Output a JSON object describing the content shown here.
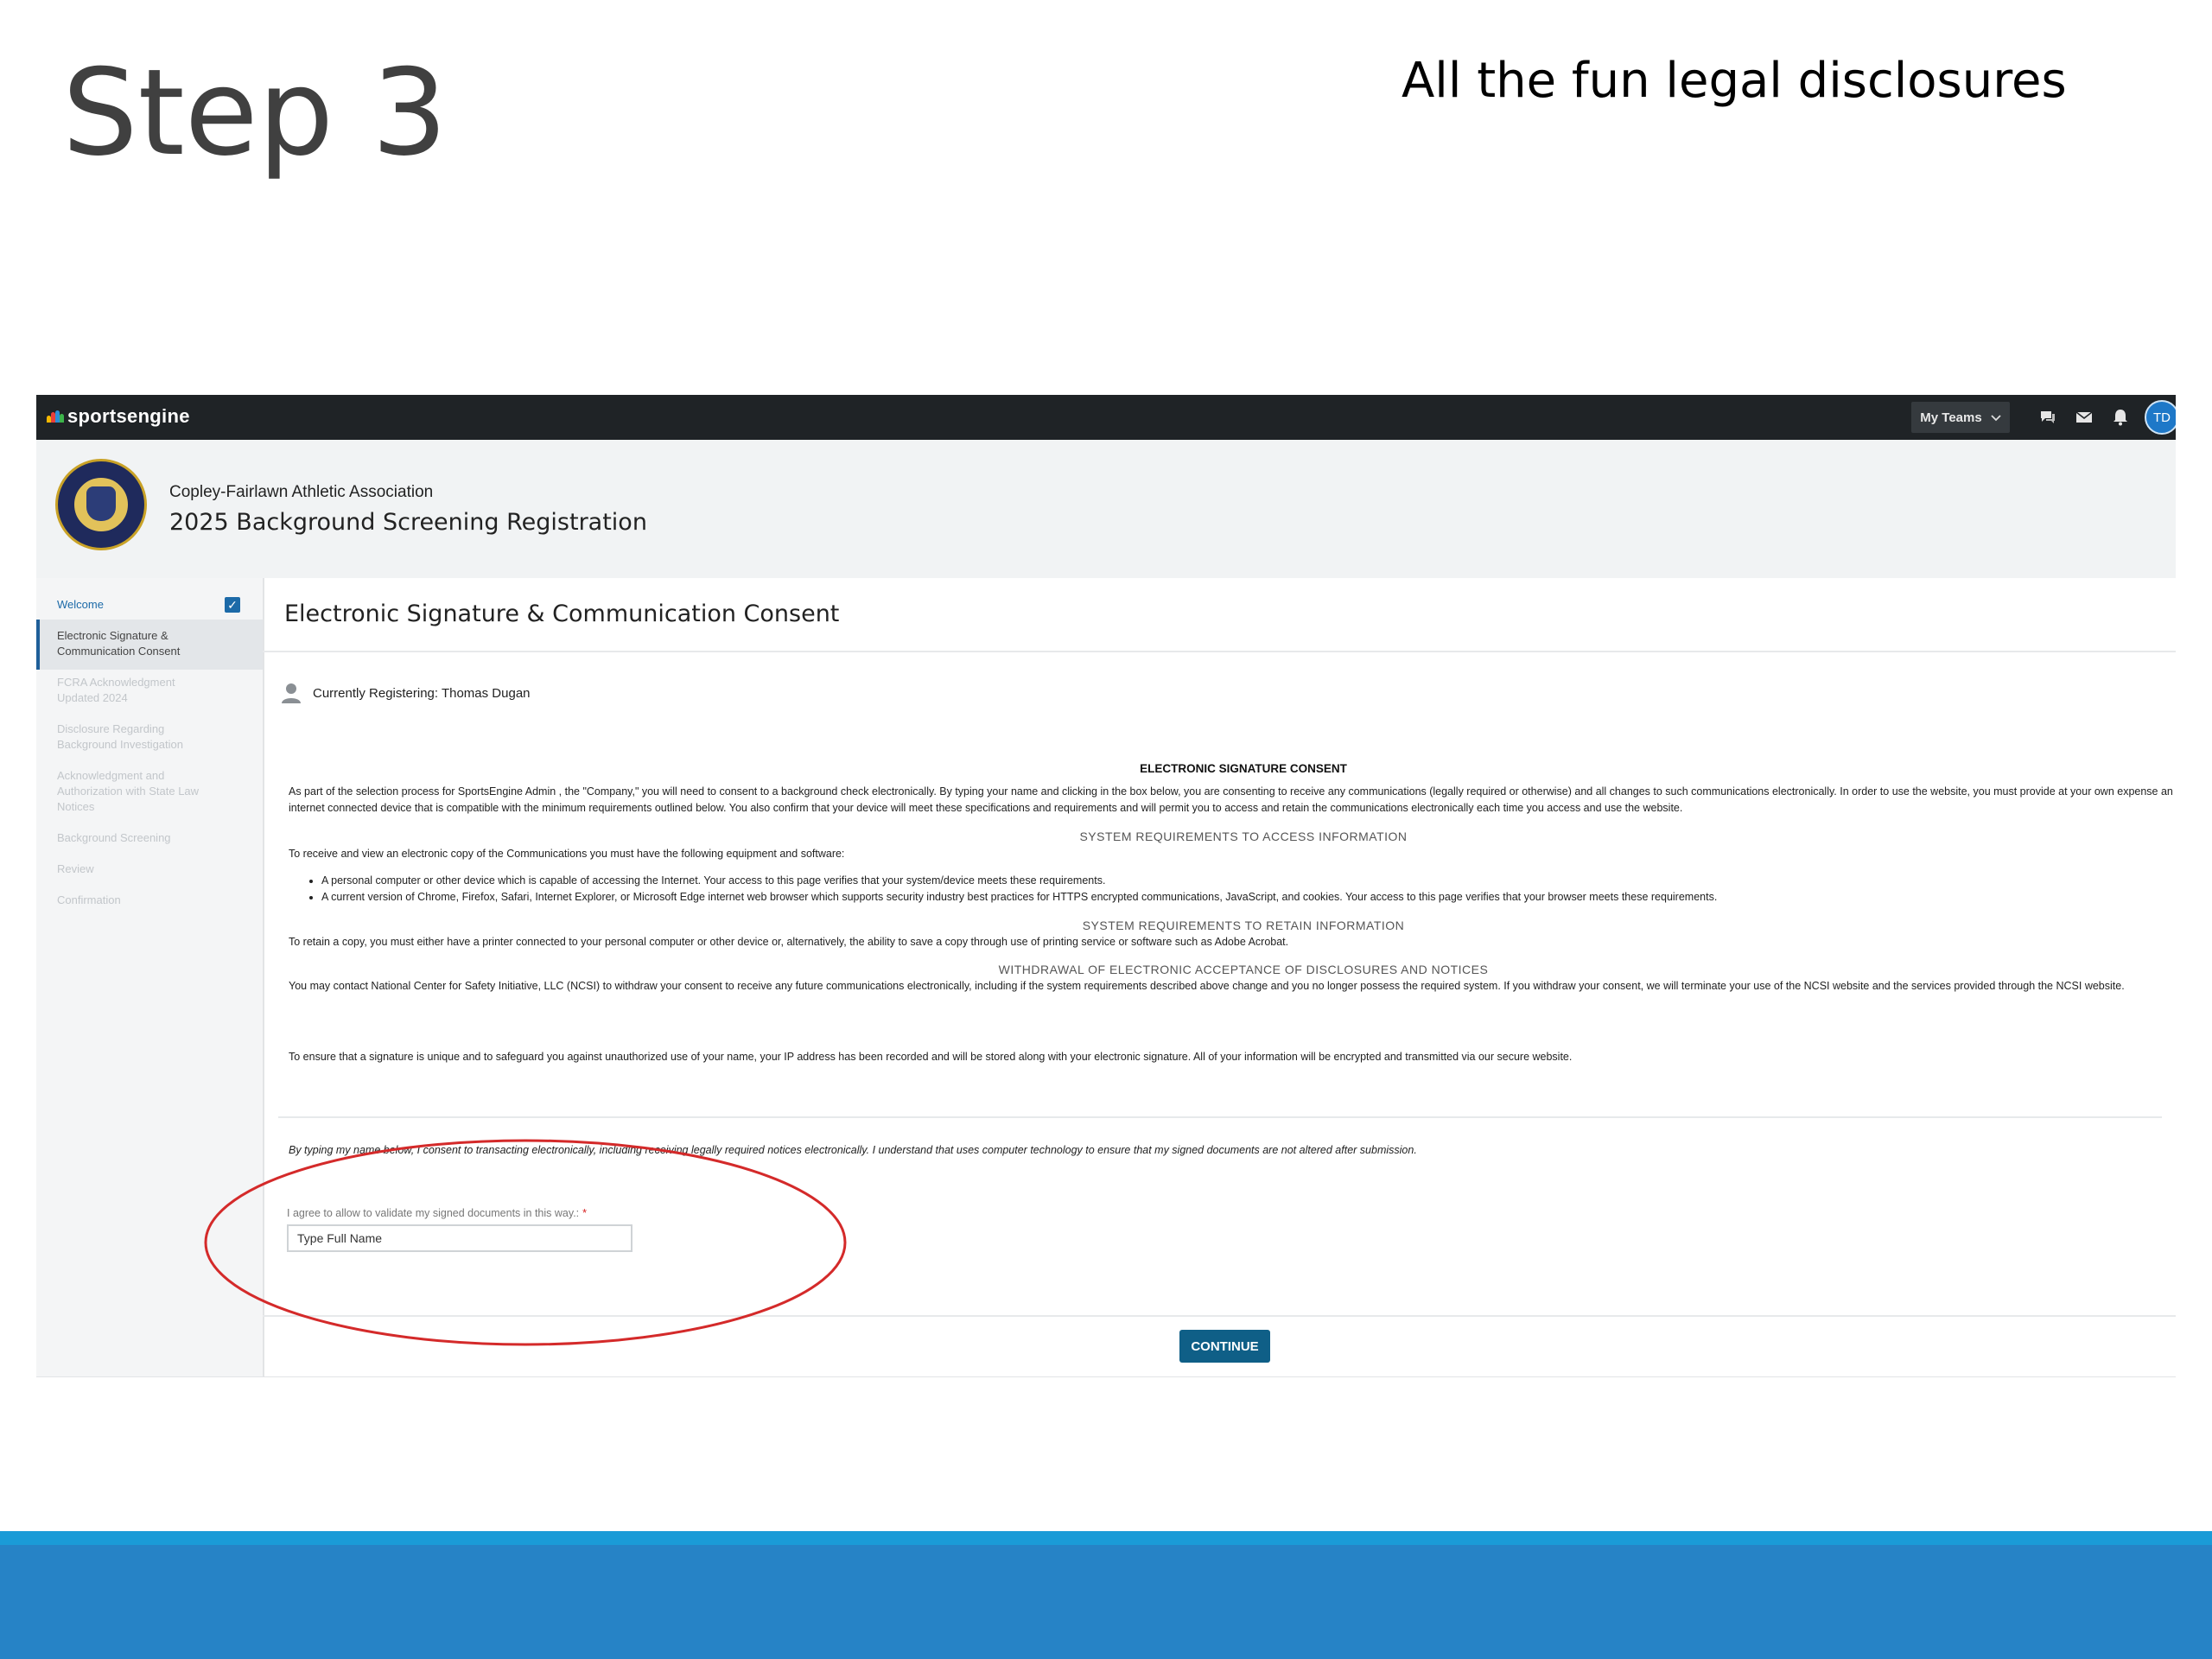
{
  "slide": {
    "title": "Step 3",
    "subtitle": "All the fun legal disclosures"
  },
  "topnav": {
    "brand": "sportsengine",
    "my_teams": "My Teams",
    "avatar_initials": "TD",
    "icons": [
      "chat-icon",
      "mail-icon",
      "bell-icon"
    ]
  },
  "header": {
    "org_name": "Copley-Fairlawn Athletic Association",
    "registration_title": "2025 Background Screening Registration"
  },
  "sidebar": {
    "items": [
      {
        "label": "Welcome",
        "state": "done"
      },
      {
        "label": "Electronic Signature & Communication Consent",
        "state": "active"
      },
      {
        "label": "FCRA Acknowledgment Updated 2024",
        "state": "disabled"
      },
      {
        "label": "Disclosure Regarding Background Investigation",
        "state": "disabled"
      },
      {
        "label": "Acknowledgment and Authorization with State Law Notices",
        "state": "disabled"
      },
      {
        "label": "Background Screening",
        "state": "disabled"
      },
      {
        "label": "Review",
        "state": "disabled"
      },
      {
        "label": "Confirmation",
        "state": "disabled"
      }
    ]
  },
  "main": {
    "title": "Electronic Signature & Communication Consent",
    "registering": "Currently Registering: Thomas Dugan",
    "consent_heading": "ELECTRONIC SIGNATURE CONSENT",
    "consent_para": "As part of the selection process for SportsEngine Admin , the \"Company,\" you will need to consent to a background check electronically. By typing your name and clicking in the box below, you are consenting to receive any communications (legally required or otherwise) and all changes to such communications electronically. In order to use the website, you must provide at your own expense an internet connected device that is compatible with the minimum requirements outlined below. You also confirm that your device will meet these specifications and requirements and will permit you to access and retain the communications electronically each time you access and use the website.",
    "access_heading": "SYSTEM REQUIREMENTS TO ACCESS INFORMATION",
    "access_intro": "To receive and view an electronic copy of the Communications you must have the following equipment and software:",
    "access_bullets": [
      "A personal computer or other device which is capable of accessing the Internet. Your access to this page verifies that your system/device meets these requirements.",
      "A current version of Chrome, Firefox, Safari, Internet Explorer, or Microsoft Edge internet web browser which supports security industry best practices for HTTPS encrypted communications, JavaScript, and cookies. Your access to this page verifies that your browser meets these requirements."
    ],
    "retain_heading": "SYSTEM REQUIREMENTS TO RETAIN INFORMATION",
    "retain_para": "To retain a copy, you must either have a printer connected to your personal computer or other device or, alternatively, the ability to save a copy through use of printing service or software such as Adobe Acrobat.",
    "withdrawal_heading": "WITHDRAWAL OF ELECTRONIC ACCEPTANCE OF DISCLOSURES AND NOTICES",
    "withdrawal_para": "You may contact National Center for Safety Initiative, LLC (NCSI) to withdraw your consent to receive any future communications electronically, including if the system requirements described above change and you no longer possess the required system. If you withdraw your consent, we will terminate your use of the NCSI website and the services provided through the NCSI website.",
    "signature_para": "To ensure that a signature is unique and to safeguard you against unauthorized use of your name, your IP address has been recorded and will be stored along with your electronic signature. All of your information will be encrypted and transmitted via our secure website.",
    "agreement_text": "By typing my name below, I consent to transacting electronically, including receiving legally required notices electronically. I understand that uses computer technology to ensure that my signed documents are not altered after submission.",
    "field_label": "I agree to allow to validate my signed documents in this way.:",
    "required_mark": "*",
    "name_placeholder": "Type Full Name",
    "continue_label": "CONTINUE"
  },
  "colors": {
    "nav_bg": "#1f2326",
    "accent": "#0f5f87",
    "annotation_circle": "#d42a2a",
    "footer": "#2683c6"
  }
}
